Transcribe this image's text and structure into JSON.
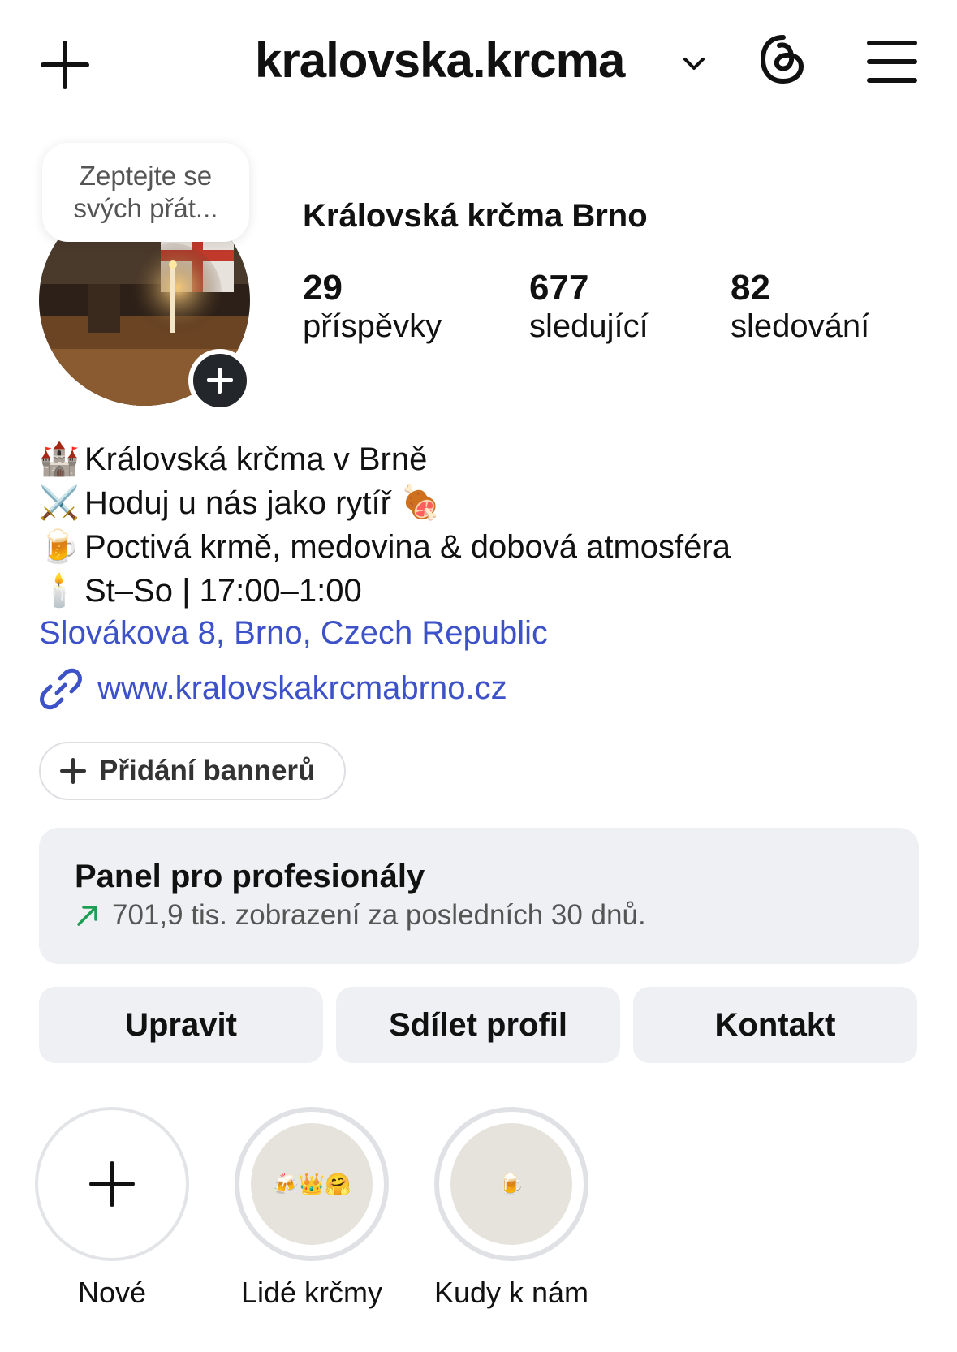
{
  "header": {
    "username": "kralovska.krcma",
    "icons": [
      "plus-icon",
      "chevron-down-icon",
      "threads-icon",
      "menu-icon"
    ]
  },
  "profile": {
    "note": "Zeptejte se svých přát...",
    "display_name": "Královská krčma Brno",
    "stats": [
      {
        "value": "29",
        "label": "příspěvky"
      },
      {
        "value": "677",
        "label": "sledující"
      },
      {
        "value": "82",
        "label": "sledování"
      }
    ],
    "bio": [
      {
        "emoji": "🏰",
        "text": "Královská krčma v Brně"
      },
      {
        "emoji": "⚔️",
        "text": "Hoduj u nás jako rytíř 🍖"
      },
      {
        "emoji": "🍺",
        "text": "Poctivá krmě, medovina & dobová atmosféra"
      },
      {
        "emoji": "🕯️",
        "text": "St–So | 17:00–1:00"
      }
    ],
    "address": "Slovákova 8, Brno, Czech Republic",
    "website": "www.kralovskakrcmabrno.cz",
    "link_color": "#3d52c8"
  },
  "banner": {
    "label": "Přidání bannerů"
  },
  "pro_panel": {
    "title": "Panel pro profesionály",
    "stats": "701,9 tis. zobrazení za posledních 30 dnů.",
    "trend_color": "#1f9d55"
  },
  "actions": [
    {
      "label": "Upravit"
    },
    {
      "label": "Sdílet profil"
    },
    {
      "label": "Kontakt"
    }
  ],
  "highlights": [
    {
      "label": "Nové",
      "cover": ""
    },
    {
      "label": "Lidé krčmy",
      "cover": "🍻👑🤗"
    },
    {
      "label": "Kudy k nám",
      "cover": "🍺"
    }
  ]
}
